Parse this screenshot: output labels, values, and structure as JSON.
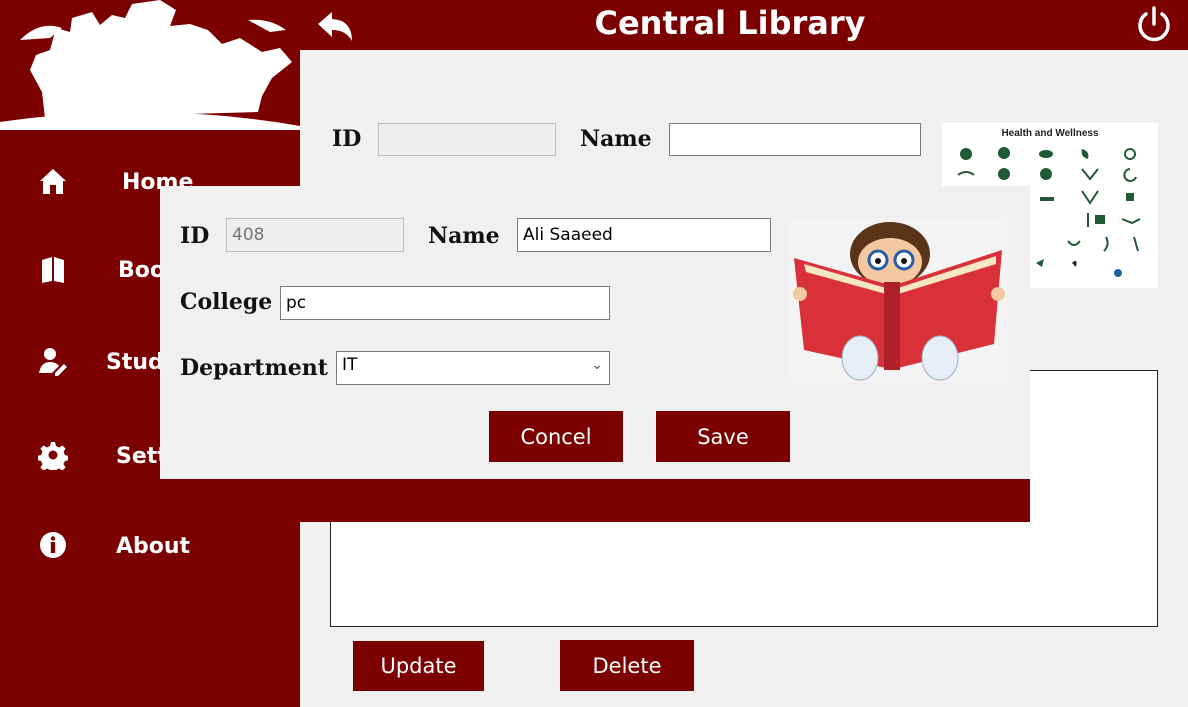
{
  "header": {
    "title": "Central Library"
  },
  "sidebar": {
    "items": [
      {
        "label": "Home"
      },
      {
        "label": "Books"
      },
      {
        "label": "Students"
      },
      {
        "label": "Settings"
      },
      {
        "label": "About"
      }
    ]
  },
  "main_form": {
    "id_label": "ID",
    "id_value": "",
    "name_label": "Name",
    "name_value": "",
    "thumb_title": "Health and Wellness",
    "update_label": "Update",
    "delete_label": "Delete"
  },
  "dialog": {
    "id_label": "ID",
    "id_value": "408",
    "name_label": "Name",
    "name_value": "Ali Saaeed",
    "college_label": "College",
    "college_value": "pc",
    "department_label": "Department",
    "department_value": "IT",
    "cancel_label": "Concel",
    "save_label": "Save"
  },
  "colors": {
    "brand": "#7b0000",
    "panel": "#f0f0f0"
  }
}
